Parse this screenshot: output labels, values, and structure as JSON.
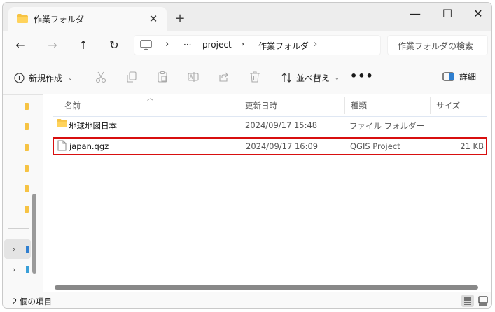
{
  "tab": {
    "title": "作業フォルダ",
    "close_glyph": "✕",
    "new_glyph": "+"
  },
  "window_controls": {
    "minimize": "—",
    "maximize": "☐",
    "close": "✕"
  },
  "nav": {
    "back": "←",
    "forward": "→",
    "up": "↑",
    "refresh": "↻"
  },
  "address": {
    "overflow": "···",
    "separator": "›",
    "crumbs": [
      "project",
      "作業フォルダ"
    ]
  },
  "search": {
    "placeholder": "作業フォルダの検索"
  },
  "commands": {
    "new_label": "新規作成",
    "new_icon": "plus-circle-icon",
    "sort_label": "並べ替え",
    "more": "•••",
    "details_label": "詳細",
    "disabled_icons": [
      "cut-icon",
      "copy-icon",
      "paste-icon",
      "rename-icon",
      "share-icon",
      "delete-icon"
    ]
  },
  "columns": {
    "name": "名前",
    "date": "更新日時",
    "type": "種類",
    "size": "サイズ"
  },
  "files": [
    {
      "name": "地球地図日本",
      "date": "2024/09/17 15:48",
      "type": "ファイル フォルダー",
      "size": "",
      "icon": "folder-icon"
    },
    {
      "name": "japan.qgz",
      "date": "2024/09/17 16:09",
      "type": "QGIS Project",
      "size": "21 KB",
      "icon": "file-icon",
      "highlighted": true
    }
  ],
  "nav_pane": {
    "expand_glyph": "›"
  },
  "status": {
    "item_count": "2 個の項目"
  },
  "colors": {
    "folder": "#f6c344",
    "highlight_border": "#d80f0f",
    "accent": "#2f7fd0"
  }
}
